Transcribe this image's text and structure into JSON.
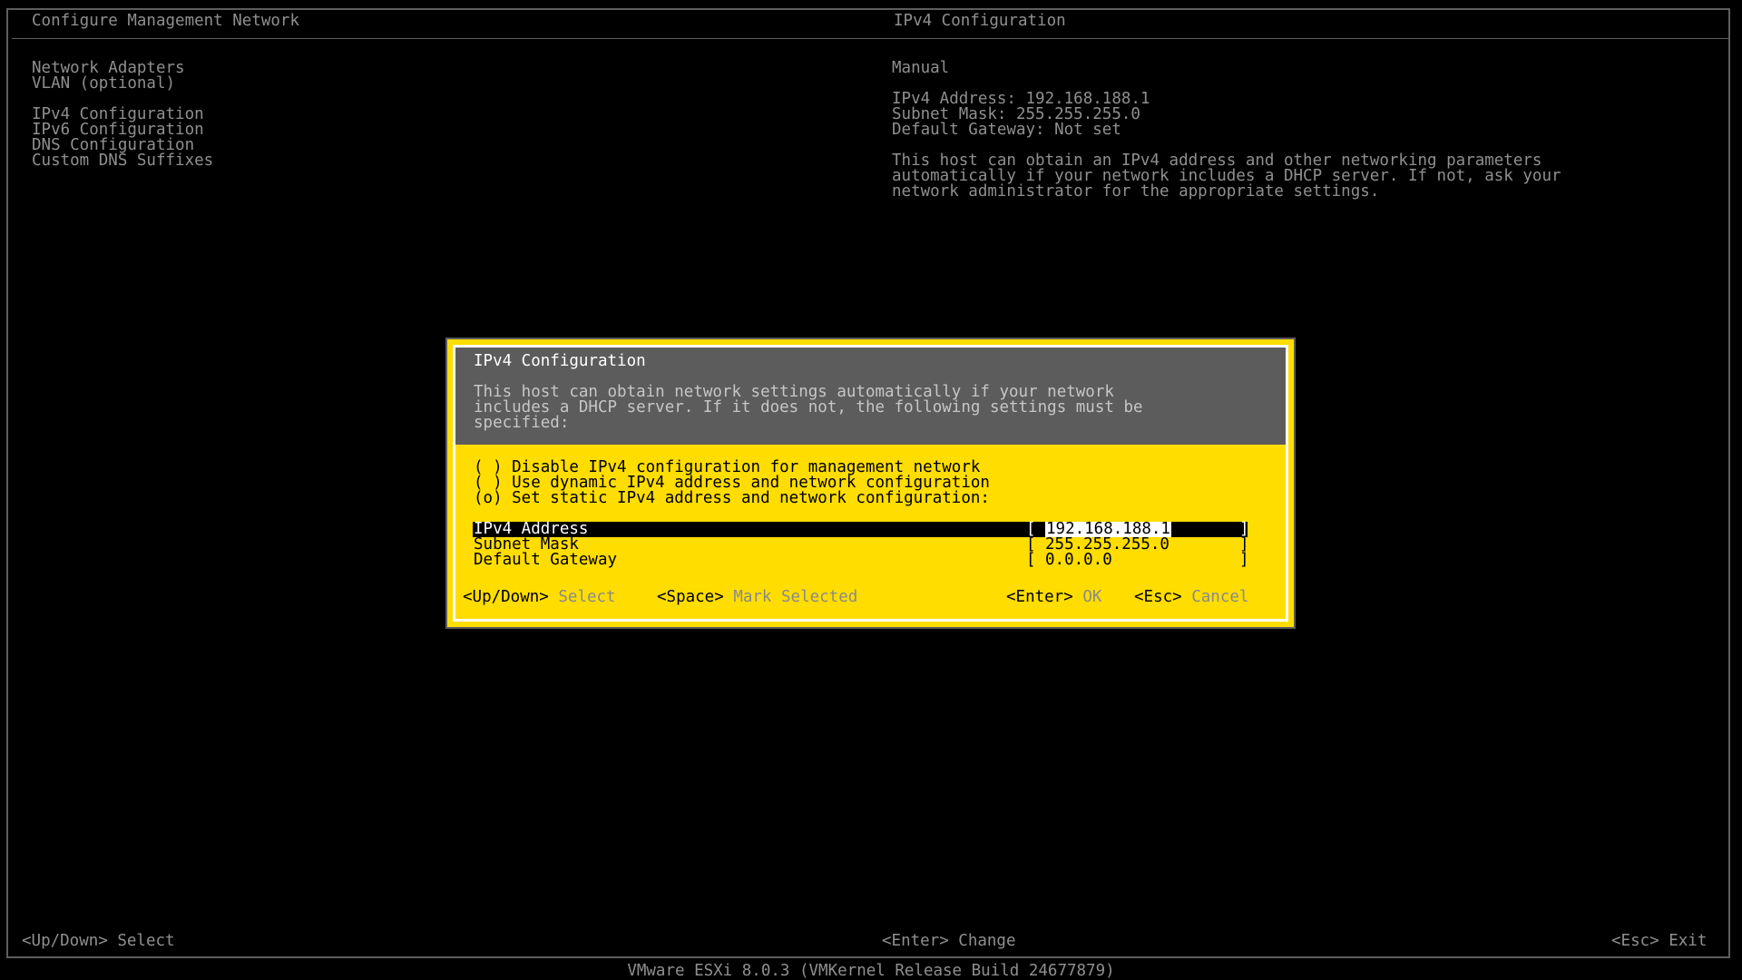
{
  "header": {
    "left_title": "Configure Management Network",
    "right_title": "IPv4 Configuration"
  },
  "menu": {
    "group1": [
      "Network Adapters",
      "VLAN (optional)"
    ],
    "group2": [
      "IPv4 Configuration",
      "IPv6 Configuration",
      "DNS Configuration",
      "Custom DNS Suffixes"
    ]
  },
  "info": {
    "mode": "Manual",
    "ipv4_address": "IPv4 Address: 192.168.188.1",
    "subnet_mask": "Subnet Mask: 255.255.255.0",
    "default_gateway": "Default Gateway: Not set",
    "description": [
      "This host can obtain an IPv4 address and other networking parameters",
      "automatically if your network includes a DHCP server. If not, ask your",
      "network administrator for the appropriate settings."
    ]
  },
  "dialog": {
    "title": "IPv4 Configuration",
    "description": [
      "This host can obtain network settings automatically if your network",
      "includes a DHCP server. If it does not, the following settings must be",
      "specified:"
    ],
    "options": [
      "( ) Disable IPv4 configuration for management network",
      "( ) Use dynamic IPv4 address and network configuration",
      "(o) Set static IPv4 address and network configuration:"
    ],
    "fields": [
      {
        "label": "IPv4 Address",
        "value": "192.168.188.1"
      },
      {
        "label": "Subnet Mask",
        "value": "255.255.255.0"
      },
      {
        "label": "Default Gateway",
        "value": "0.0.0.0"
      }
    ],
    "footer": {
      "updown_key": "<Up/Down>",
      "updown_action": "Select",
      "space_key": "<Space>",
      "space_action": "Mark Selected",
      "enter_key": "<Enter>",
      "enter_action": "OK",
      "esc_key": "<Esc>",
      "esc_action": "Cancel"
    }
  },
  "bottom_bar": {
    "left": "<Up/Down> Select",
    "center": "<Enter> Change",
    "right": "<Esc> Exit"
  },
  "version": "VMware ESXi 8.0.3 (VMKernel Release Build 24677879)"
}
